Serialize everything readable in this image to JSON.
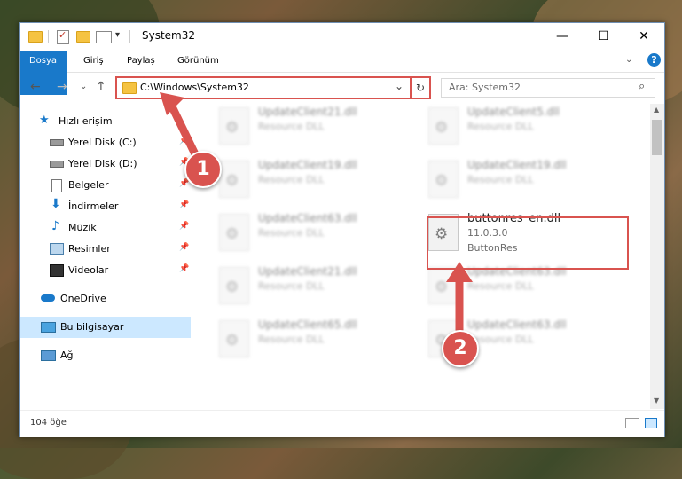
{
  "window": {
    "title": "System32",
    "minimize_label": "—",
    "maximize_label": "☐",
    "close_label": "✕"
  },
  "ribbon": {
    "tabs": [
      "Dosya",
      "Giriş",
      "Paylaş",
      "Görünüm"
    ],
    "help_label": "?"
  },
  "address": {
    "path": "C:\\Windows\\System32",
    "search_placeholder": "Ara: System32"
  },
  "navigation": {
    "items": [
      {
        "label": "Hızlı erişim",
        "icon": "star-icon",
        "pinned": false
      },
      {
        "label": "Yerel Disk (C:)",
        "icon": "drive-icon",
        "pinned": true
      },
      {
        "label": "Yerel Disk (D:)",
        "icon": "drive-icon",
        "pinned": true
      },
      {
        "label": "Belgeler",
        "icon": "documents-icon",
        "pinned": true
      },
      {
        "label": "İndirmeler",
        "icon": "download-icon",
        "pinned": true
      },
      {
        "label": "Müzik",
        "icon": "music-icon",
        "pinned": true
      },
      {
        "label": "Resimler",
        "icon": "pictures-icon",
        "pinned": true
      },
      {
        "label": "Videolar",
        "icon": "videos-icon",
        "pinned": true
      },
      {
        "label": "OneDrive",
        "icon": "cloud-icon",
        "pinned": false
      },
      {
        "label": "Bu bilgisayar",
        "icon": "computer-icon",
        "pinned": false,
        "selected": true
      },
      {
        "label": "Ağ",
        "icon": "network-icon",
        "pinned": false
      }
    ]
  },
  "files": [
    {
      "name": "UpdateClient21.dll",
      "type": "Resource DLL"
    },
    {
      "name": "UpdateClient5.dll",
      "type": "Resource DLL"
    },
    {
      "name": "UpdateClient19.dll",
      "type": "Resource DLL"
    },
    {
      "name": "UpdateClient19.dll",
      "type": "Resource DLL"
    },
    {
      "name": "UpdateClient63.dll",
      "type": "Resource DLL"
    },
    {
      "name": "UpdateClient21.dll",
      "type": "Resource DLL"
    },
    {
      "name": "UpdateClient63.dll",
      "type": "Resource DLL"
    },
    {
      "name": "UpdateClient65.dll",
      "type": "Resource DLL"
    },
    {
      "name": "UpdateClient63.dll",
      "type": "Resource DLL"
    }
  ],
  "highlighted_file": {
    "name": "buttonres_en.dll",
    "version": "11.0.3.0",
    "description": "ButtonRes"
  },
  "status": {
    "item_count": "104 öğe"
  },
  "callouts": [
    "1",
    "2"
  ],
  "colors": {
    "accent": "#1979ca",
    "highlight": "#d9534f",
    "selection": "#cce8ff"
  }
}
